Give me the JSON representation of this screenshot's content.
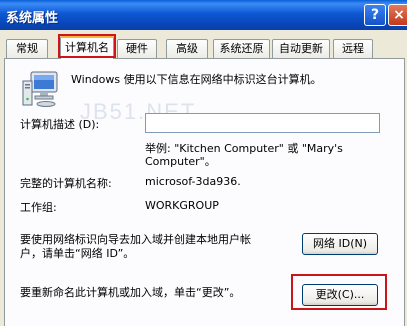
{
  "window": {
    "title": "系统属性",
    "help_glyph": "?",
    "close_glyph": "×"
  },
  "tabs": [
    {
      "label": "常规"
    },
    {
      "label": "计算机名"
    },
    {
      "label": "硬件"
    },
    {
      "label": "高级"
    },
    {
      "label": "系统还原"
    },
    {
      "label": "自动更新"
    },
    {
      "label": "远程"
    }
  ],
  "watermark": "JB51.NET",
  "panel": {
    "intro": "Windows 使用以下信息在网络中标识这台计算机。",
    "description_label": "计算机描述 (D):",
    "description_value": "",
    "example_line1": "举例: \"Kitchen Computer\" 或 \"Mary's",
    "example_line2": "Computer\"。",
    "full_name_label": "完整的计算机名称:",
    "full_name_value": "microsof-3da936.",
    "workgroup_label": "工作组:",
    "workgroup_value": "WORKGROUP",
    "network_text_line1": "要使用网络标识向导去加入域并创建本地用户帐",
    "network_text_line2": "户，请单击“网络 ID”。",
    "network_id_button": "网络 ID(N)",
    "rename_text": "要重新命名此计算机或加入域，单击“更改”。",
    "change_button": "更改(C)..."
  }
}
